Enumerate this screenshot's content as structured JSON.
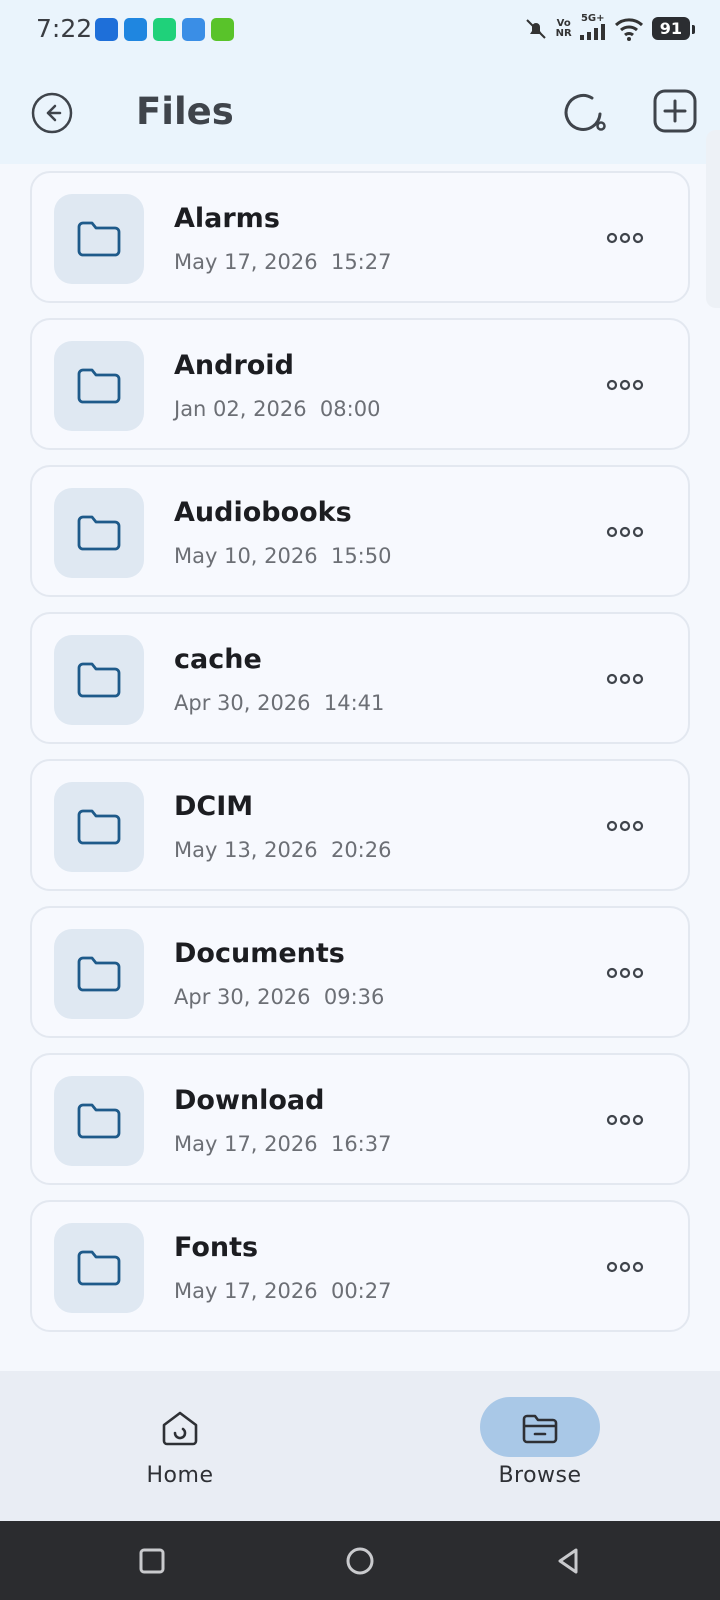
{
  "status_bar": {
    "time": "7:22",
    "network_top": "Vo",
    "network_bottom": "NR",
    "signal_label": "5G+",
    "battery": "91",
    "notification_colors": [
      "#1e6fd9",
      "#1f86e0",
      "#1fd17a",
      "#3a8ee6",
      "#59c32a"
    ]
  },
  "app_bar": {
    "title": "Files",
    "back_icon": "back-arrow-circle-icon",
    "refresh_icon": "refresh-icon",
    "add_icon": "add-square-icon"
  },
  "files": [
    {
      "name": "Alarms",
      "date": "May 17, 2026  15:27"
    },
    {
      "name": "Android",
      "date": "Jan 02, 2026  08:00"
    },
    {
      "name": "Audiobooks",
      "date": "May 10, 2026  15:50"
    },
    {
      "name": "cache",
      "date": "Apr 30, 2026  14:41"
    },
    {
      "name": "DCIM",
      "date": "May 13, 2026  20:26"
    },
    {
      "name": "Documents",
      "date": "Apr 30, 2026  09:36"
    },
    {
      "name": "Download",
      "date": "May 17, 2026  16:37"
    },
    {
      "name": "Fonts",
      "date": "May 17, 2026  00:27"
    }
  ],
  "bottom_nav": {
    "home_label": "Home",
    "browse_label": "Browse",
    "selected": "Browse"
  },
  "colors": {
    "accent": "#1e5a8a",
    "selected_pill": "#a9c8e7",
    "folder_tile": "#dfe8f2"
  }
}
